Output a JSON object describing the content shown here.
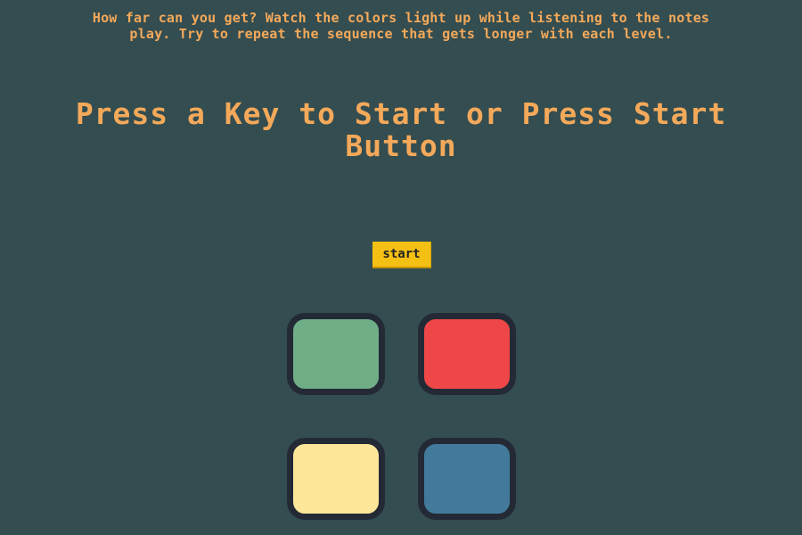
{
  "instructions": {
    "line1": "How far can you get? Watch the colors light up while listening to the notes",
    "line2": "play. Try to repeat the sequence that gets longer with each level."
  },
  "level_title": {
    "line1": "Press a Key to Start or Press Start",
    "line2": "Button"
  },
  "start_button": {
    "label": "start"
  },
  "pads": [
    {
      "name": "green",
      "color": "#6fae87"
    },
    {
      "name": "red",
      "color": "#ef4747"
    },
    {
      "name": "yellow",
      "color": "#ffe799"
    },
    {
      "name": "blue",
      "color": "#437a9b"
    }
  ],
  "colors": {
    "background": "#344d50",
    "text_accent": "#f4a95a",
    "button": "#f5c014",
    "pad_border": "#232a36"
  }
}
